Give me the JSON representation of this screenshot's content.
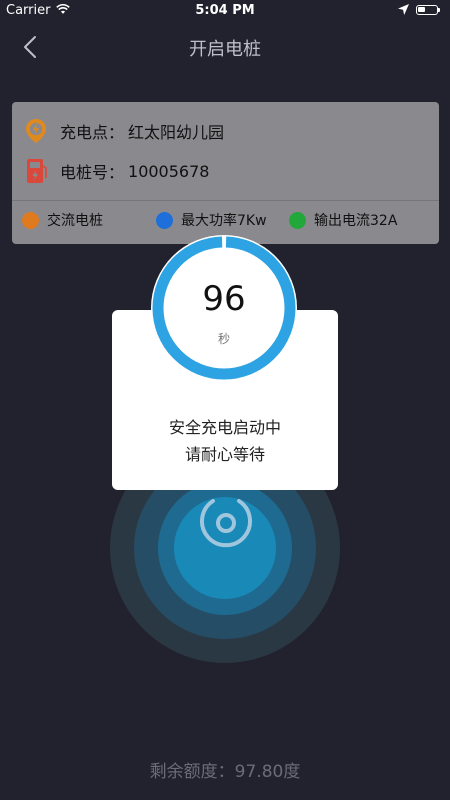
{
  "status_bar": {
    "carrier": "Carrier",
    "time": "5:04 PM"
  },
  "nav": {
    "title": "开启电桩"
  },
  "station": {
    "point_label": "充电点：",
    "point_value": "红太阳幼儿园",
    "pile_label": "电桩号：",
    "pile_value": "10005678"
  },
  "tags": [
    {
      "label": "交流电桩",
      "color": "#e07a1f"
    },
    {
      "label": "最大功率7Kw",
      "color": "#1e6fd9"
    },
    {
      "label": "输出电流32A",
      "color": "#22a83a"
    }
  ],
  "timer": {
    "value": "96",
    "unit": "秒",
    "progress": 0.99
  },
  "dialog": {
    "line1": "安全充电启动中",
    "line2": "请耐心等待"
  },
  "balance": {
    "text": "剩余额度：97.80度"
  },
  "colors": {
    "accent": "#2ea3e3",
    "background": "#22222e"
  }
}
